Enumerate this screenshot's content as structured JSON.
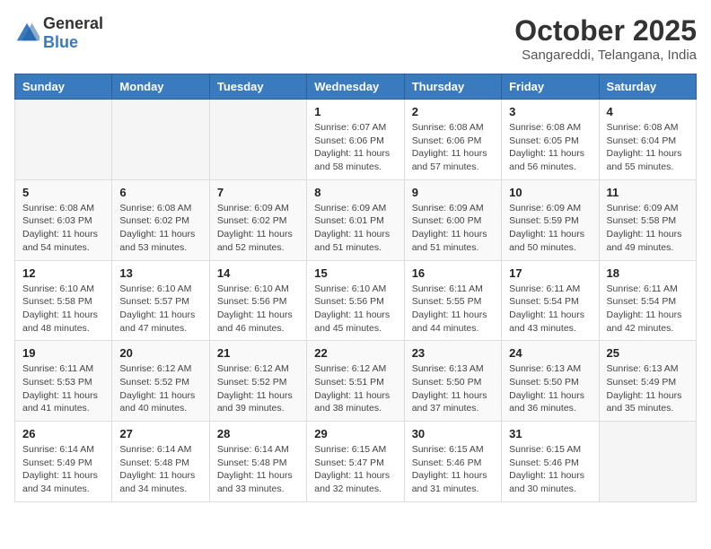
{
  "logo": {
    "general": "General",
    "blue": "Blue"
  },
  "header": {
    "month": "October 2025",
    "location": "Sangareddi, Telangana, India"
  },
  "weekdays": [
    "Sunday",
    "Monday",
    "Tuesday",
    "Wednesday",
    "Thursday",
    "Friday",
    "Saturday"
  ],
  "weeks": [
    [
      {
        "day": "",
        "info": ""
      },
      {
        "day": "",
        "info": ""
      },
      {
        "day": "",
        "info": ""
      },
      {
        "day": "1",
        "info": "Sunrise: 6:07 AM\nSunset: 6:06 PM\nDaylight: 11 hours\nand 58 minutes."
      },
      {
        "day": "2",
        "info": "Sunrise: 6:08 AM\nSunset: 6:06 PM\nDaylight: 11 hours\nand 57 minutes."
      },
      {
        "day": "3",
        "info": "Sunrise: 6:08 AM\nSunset: 6:05 PM\nDaylight: 11 hours\nand 56 minutes."
      },
      {
        "day": "4",
        "info": "Sunrise: 6:08 AM\nSunset: 6:04 PM\nDaylight: 11 hours\nand 55 minutes."
      }
    ],
    [
      {
        "day": "5",
        "info": "Sunrise: 6:08 AM\nSunset: 6:03 PM\nDaylight: 11 hours\nand 54 minutes."
      },
      {
        "day": "6",
        "info": "Sunrise: 6:08 AM\nSunset: 6:02 PM\nDaylight: 11 hours\nand 53 minutes."
      },
      {
        "day": "7",
        "info": "Sunrise: 6:09 AM\nSunset: 6:02 PM\nDaylight: 11 hours\nand 52 minutes."
      },
      {
        "day": "8",
        "info": "Sunrise: 6:09 AM\nSunset: 6:01 PM\nDaylight: 11 hours\nand 51 minutes."
      },
      {
        "day": "9",
        "info": "Sunrise: 6:09 AM\nSunset: 6:00 PM\nDaylight: 11 hours\nand 51 minutes."
      },
      {
        "day": "10",
        "info": "Sunrise: 6:09 AM\nSunset: 5:59 PM\nDaylight: 11 hours\nand 50 minutes."
      },
      {
        "day": "11",
        "info": "Sunrise: 6:09 AM\nSunset: 5:58 PM\nDaylight: 11 hours\nand 49 minutes."
      }
    ],
    [
      {
        "day": "12",
        "info": "Sunrise: 6:10 AM\nSunset: 5:58 PM\nDaylight: 11 hours\nand 48 minutes."
      },
      {
        "day": "13",
        "info": "Sunrise: 6:10 AM\nSunset: 5:57 PM\nDaylight: 11 hours\nand 47 minutes."
      },
      {
        "day": "14",
        "info": "Sunrise: 6:10 AM\nSunset: 5:56 PM\nDaylight: 11 hours\nand 46 minutes."
      },
      {
        "day": "15",
        "info": "Sunrise: 6:10 AM\nSunset: 5:56 PM\nDaylight: 11 hours\nand 45 minutes."
      },
      {
        "day": "16",
        "info": "Sunrise: 6:11 AM\nSunset: 5:55 PM\nDaylight: 11 hours\nand 44 minutes."
      },
      {
        "day": "17",
        "info": "Sunrise: 6:11 AM\nSunset: 5:54 PM\nDaylight: 11 hours\nand 43 minutes."
      },
      {
        "day": "18",
        "info": "Sunrise: 6:11 AM\nSunset: 5:54 PM\nDaylight: 11 hours\nand 42 minutes."
      }
    ],
    [
      {
        "day": "19",
        "info": "Sunrise: 6:11 AM\nSunset: 5:53 PM\nDaylight: 11 hours\nand 41 minutes."
      },
      {
        "day": "20",
        "info": "Sunrise: 6:12 AM\nSunset: 5:52 PM\nDaylight: 11 hours\nand 40 minutes."
      },
      {
        "day": "21",
        "info": "Sunrise: 6:12 AM\nSunset: 5:52 PM\nDaylight: 11 hours\nand 39 minutes."
      },
      {
        "day": "22",
        "info": "Sunrise: 6:12 AM\nSunset: 5:51 PM\nDaylight: 11 hours\nand 38 minutes."
      },
      {
        "day": "23",
        "info": "Sunrise: 6:13 AM\nSunset: 5:50 PM\nDaylight: 11 hours\nand 37 minutes."
      },
      {
        "day": "24",
        "info": "Sunrise: 6:13 AM\nSunset: 5:50 PM\nDaylight: 11 hours\nand 36 minutes."
      },
      {
        "day": "25",
        "info": "Sunrise: 6:13 AM\nSunset: 5:49 PM\nDaylight: 11 hours\nand 35 minutes."
      }
    ],
    [
      {
        "day": "26",
        "info": "Sunrise: 6:14 AM\nSunset: 5:49 PM\nDaylight: 11 hours\nand 34 minutes."
      },
      {
        "day": "27",
        "info": "Sunrise: 6:14 AM\nSunset: 5:48 PM\nDaylight: 11 hours\nand 34 minutes."
      },
      {
        "day": "28",
        "info": "Sunrise: 6:14 AM\nSunset: 5:48 PM\nDaylight: 11 hours\nand 33 minutes."
      },
      {
        "day": "29",
        "info": "Sunrise: 6:15 AM\nSunset: 5:47 PM\nDaylight: 11 hours\nand 32 minutes."
      },
      {
        "day": "30",
        "info": "Sunrise: 6:15 AM\nSunset: 5:46 PM\nDaylight: 11 hours\nand 31 minutes."
      },
      {
        "day": "31",
        "info": "Sunrise: 6:15 AM\nSunset: 5:46 PM\nDaylight: 11 hours\nand 30 minutes."
      },
      {
        "day": "",
        "info": ""
      }
    ]
  ]
}
